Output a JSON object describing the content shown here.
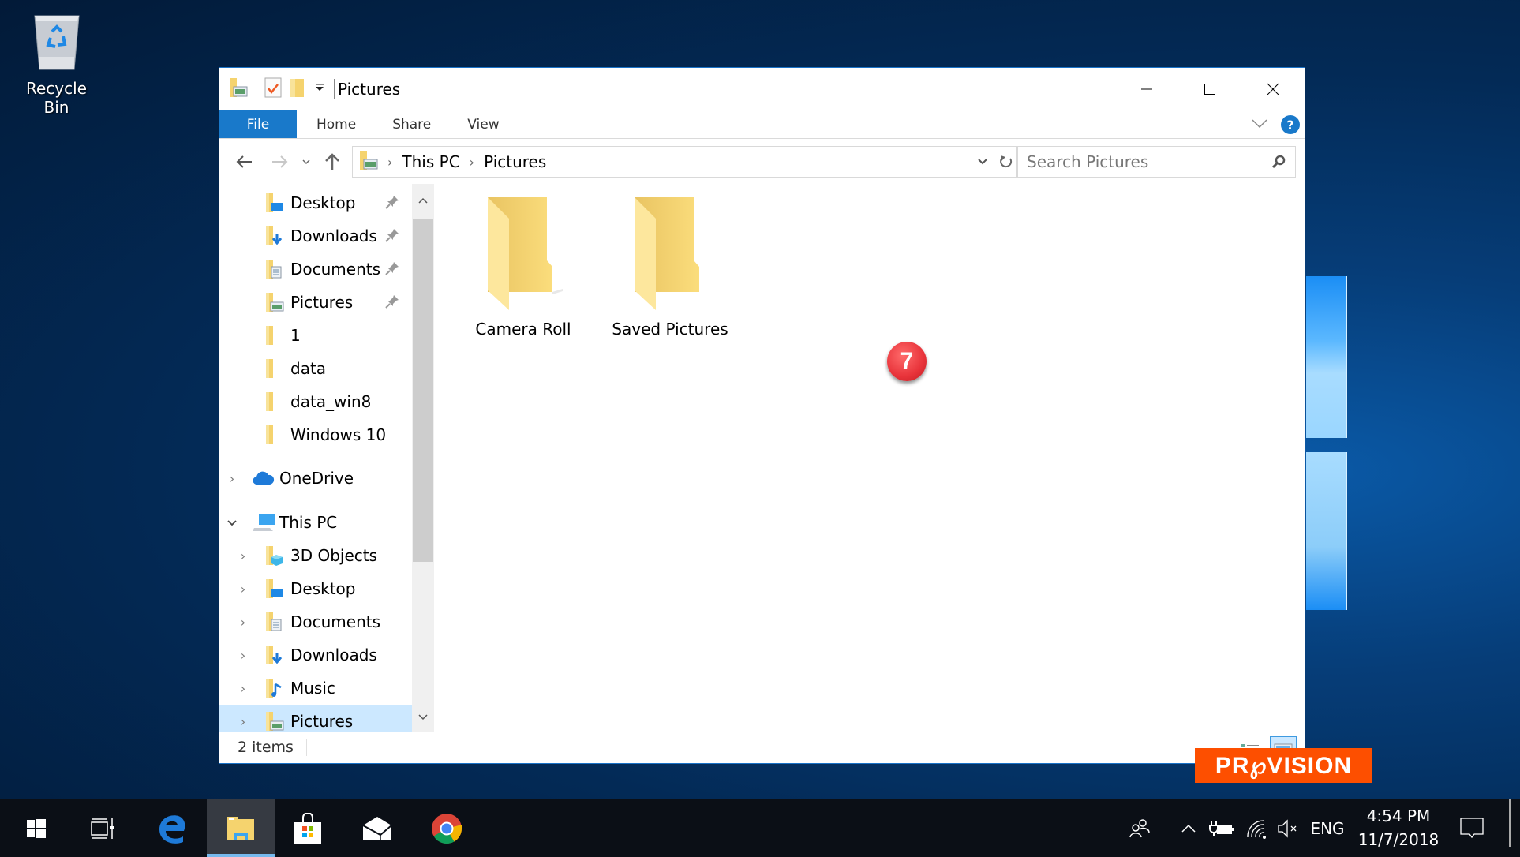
{
  "desktop": {
    "icons": [
      {
        "label": "Recycle Bin",
        "icon": "recycle-bin-icon"
      }
    ]
  },
  "window": {
    "title": "Pictures",
    "quick_access_toolbar": [
      "properties-icon",
      "new-folder-icon",
      "customize-dropdown-icon"
    ],
    "controls": {
      "minimize": "Minimize",
      "maximize": "Maximize",
      "close": "Close"
    },
    "ribbon": {
      "tabs": [
        {
          "label": "File",
          "active": true
        },
        {
          "label": "Home"
        },
        {
          "label": "Share"
        },
        {
          "label": "View"
        }
      ],
      "help_label": "?"
    },
    "address": {
      "breadcrumb": [
        "This PC",
        "Pictures"
      ],
      "search_placeholder": "Search Pictures",
      "search_value": ""
    },
    "nav_pane": {
      "quick_access": [
        {
          "label": "Desktop",
          "icon": "desktop-folder-icon",
          "pinned": true
        },
        {
          "label": "Downloads",
          "icon": "downloads-folder-icon",
          "pinned": true
        },
        {
          "label": "Documents",
          "icon": "documents-folder-icon",
          "pinned": true
        },
        {
          "label": "Pictures",
          "icon": "pictures-folder-icon",
          "pinned": true
        },
        {
          "label": "1",
          "icon": "folder-icon"
        },
        {
          "label": "data",
          "icon": "folder-icon"
        },
        {
          "label": "data_win8",
          "icon": "folder-icon"
        },
        {
          "label": "Windows 10",
          "icon": "folder-icon"
        }
      ],
      "onedrive": {
        "label": "OneDrive",
        "expanded": false
      },
      "this_pc": {
        "label": "This PC",
        "expanded": true,
        "children": [
          {
            "label": "3D Objects",
            "icon": "3d-objects-folder-icon"
          },
          {
            "label": "Desktop",
            "icon": "desktop-folder-icon"
          },
          {
            "label": "Documents",
            "icon": "documents-folder-icon"
          },
          {
            "label": "Downloads",
            "icon": "downloads-folder-icon"
          },
          {
            "label": "Music",
            "icon": "music-folder-icon"
          },
          {
            "label": "Pictures",
            "icon": "pictures-folder-icon",
            "selected": true
          }
        ]
      }
    },
    "content": {
      "items": [
        {
          "name": "Camera Roll",
          "type": "folder"
        },
        {
          "name": "Saved Pictures",
          "type": "folder"
        }
      ]
    },
    "status": {
      "item_count": "2 items"
    },
    "view_modes": [
      {
        "name": "details"
      },
      {
        "name": "large-icons",
        "active": true
      }
    ]
  },
  "annotation": {
    "step_number": "7",
    "color": "#e8333a"
  },
  "watermark": {
    "text": "PR℘VISION",
    "color": "#fd4f00"
  },
  "taskbar": {
    "apps": [
      "Start",
      "Task View",
      "Microsoft Edge",
      "File Explorer",
      "Microsoft Store",
      "Mail",
      "Google Chrome"
    ],
    "active_app": "File Explorer",
    "tray": {
      "language": "ENG",
      "time": "4:54 PM",
      "date": "11/7/2018"
    }
  },
  "colors": {
    "accent": "#1979ca",
    "selection": "#cce8ff",
    "taskbar": "#0b0f16"
  }
}
